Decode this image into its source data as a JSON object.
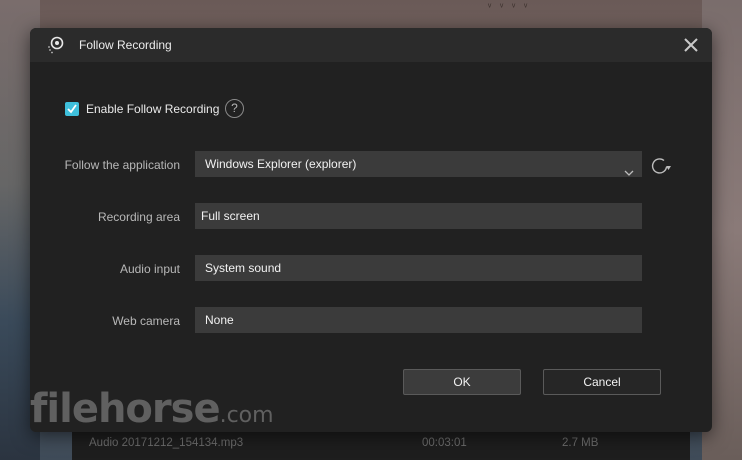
{
  "window": {
    "title": "Follow Recording"
  },
  "enable": {
    "label": "Enable Follow Recording",
    "checked": true,
    "help": "?"
  },
  "form": {
    "application": {
      "label": "Follow the application",
      "value": "Windows Explorer (explorer)"
    },
    "area": {
      "label": "Recording area",
      "value": "Full screen"
    },
    "audio": {
      "label": "Audio input",
      "value": "System sound"
    },
    "camera": {
      "label": "Web camera",
      "value": "None"
    }
  },
  "buttons": {
    "ok": "OK",
    "cancel": "Cancel"
  },
  "background_row": {
    "name": "Audio 20171212_154134.mp3",
    "duration": "00:03:01",
    "size": "2.7 MB"
  },
  "watermark": {
    "brand": "filehorse",
    "suffix": ".com"
  },
  "colors": {
    "dialog_bg": "#212121",
    "titlebar_bg": "#2b2b2b",
    "field_bg": "#3b3b3b",
    "checkbox": "#3fc0dc"
  }
}
